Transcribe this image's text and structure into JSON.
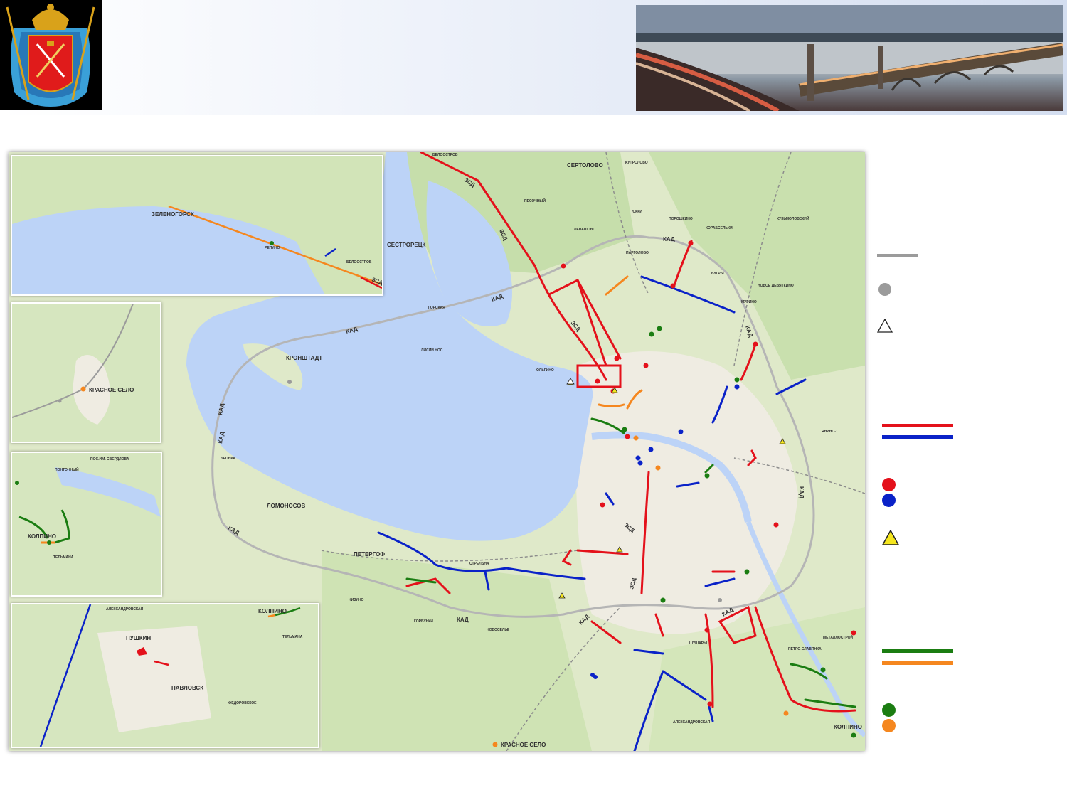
{
  "map": {
    "places": {
      "sertolovo": "СЕРТОЛОВО",
      "sestroretsk": "СЕСТРОРЕЦК",
      "kronshtadt": "КРОНШТАДТ",
      "lomonosov": "ЛОМОНОСОВ",
      "petergof": "ПЕТЕРГОФ",
      "krasnoe_selo": "КРАСНОЕ СЕЛО",
      "kolpino": "КОЛПИНО",
      "pushkin": "ПУШКИН",
      "pavlovsk": "ПАВЛОВСК",
      "zelenogorsk": "ЗЕЛЕНОГОРСК"
    },
    "small_places": {
      "beloostrov_top": "БЕЛООСТРОВ",
      "pesochny": "ПЕСОЧНЫЙ",
      "kuzmolovsky": "КУЗЬМОЛОВСКИЙ",
      "yukki": "ЮККИ",
      "poroshkino": "ПОРОШКИНО",
      "korabselki": "КОРАБСЕЛЬКИ",
      "levashovo": "ЛЕВАШОВО",
      "pargolovo": "ПАРГОЛОВО",
      "bugry": "БУГРЫ",
      "novoe_devyatkino": "НОВОЕ ДЕВЯТКИНО",
      "murino": "МУРИНО",
      "gorskaya": "ГОРСКАЯ",
      "lisy_nos": "ЛИСИЙ НОС",
      "olgino": "ОЛЬГИНО",
      "yanino": "ЯНИНО-1",
      "bronka": "БРОНКА",
      "strelna": "СТРЕЛЬНА",
      "nizino": "НИЗИНО",
      "gorbunki": "ГОРБУНКИ",
      "novoselye": "НОВОСЕЛЬЕ",
      "shushary": "ШУШАРЫ",
      "metallostroy": "МЕТАЛЛОСТРОЙ",
      "petro_slavyanka": "ПЕТРО-СЛАВЯНКА",
      "aleksandrovskaya": "АЛЕКСАНДРОВСКАЯ",
      "repino": "РЕПИНО",
      "beloostrov": "БЕЛООСТРОВ",
      "pos_sverdlova": "ПОС.ИМ. СВЕРДЛОВА",
      "pontonny": "ПОНТОННЫЙ",
      "telmana": "ТЕЛЬМАНА",
      "fedorovskoe": "ФЕДОРОВСКОЕ",
      "kuppolovo": "КУПРОЛОВО"
    },
    "roads": {
      "kad": "КАД",
      "zsd": "ЗСД"
    }
  },
  "legend": {
    "symbols": [
      "gray-line",
      "gray-circle",
      "white-triangle",
      "red-blue-lines",
      "red-blue-circles",
      "yellow-triangle",
      "green-orange-lines",
      "green-orange-circles"
    ]
  },
  "colors": {
    "red": "#e4111b",
    "blue": "#0a22c8",
    "green": "#1b7d12",
    "orange": "#f5871f",
    "yellow": "#f5e61e",
    "gray": "#9b9b9b",
    "water": "#bcd3f7"
  }
}
